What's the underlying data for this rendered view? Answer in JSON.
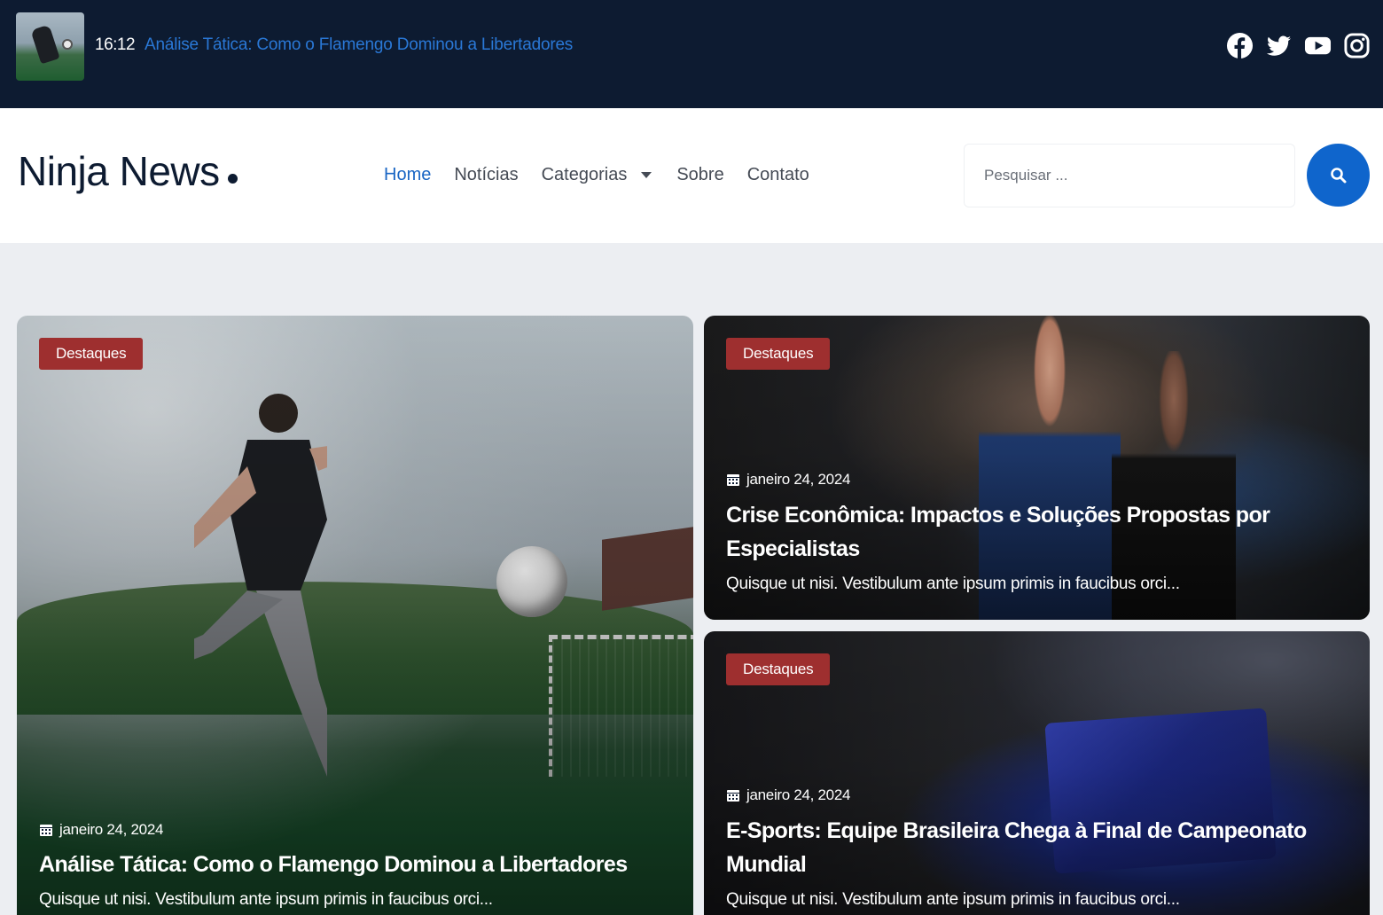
{
  "topbar": {
    "time": "16:12",
    "headline": "Análise Tática: Como o Flamengo Dominou a Libertadores",
    "socials": [
      "facebook-icon",
      "twitter-icon",
      "youtube-icon",
      "instagram-icon"
    ],
    "background": "#0d1b31",
    "headline_color": "#2a78d6"
  },
  "header": {
    "logo": "Ninja News",
    "nav": [
      {
        "label": "Home",
        "active": true
      },
      {
        "label": "Notícias"
      },
      {
        "label": "Categorias",
        "dropdown": true
      },
      {
        "label": "Sobre"
      },
      {
        "label": "Contato"
      }
    ],
    "search": {
      "placeholder": "Pesquisar ..."
    },
    "accent": "#0f65cc"
  },
  "cards": [
    {
      "badge": "Destaques",
      "date": "janeiro 24, 2024",
      "title": "Análise Tática: Como o Flamengo Dominou a Libertadores",
      "excerpt": "Quisque ut nisi. Vestibulum ante ipsum primis in faucibus orci..."
    },
    {
      "badge": "Destaques",
      "date": "janeiro 24, 2024",
      "title": "Crise Econômica: Impactos e Soluções Propostas por Especialistas",
      "excerpt": "Quisque ut nisi. Vestibulum ante ipsum primis in faucibus orci..."
    },
    {
      "badge": "Destaques",
      "date": "janeiro 24, 2024",
      "title": "E-Sports: Equipe Brasileira Chega à Final de Campeonato Mundial",
      "excerpt": "Quisque ut nisi. Vestibulum ante ipsum primis in faucibus orci..."
    }
  ],
  "badge_color": "#9e2f2f"
}
